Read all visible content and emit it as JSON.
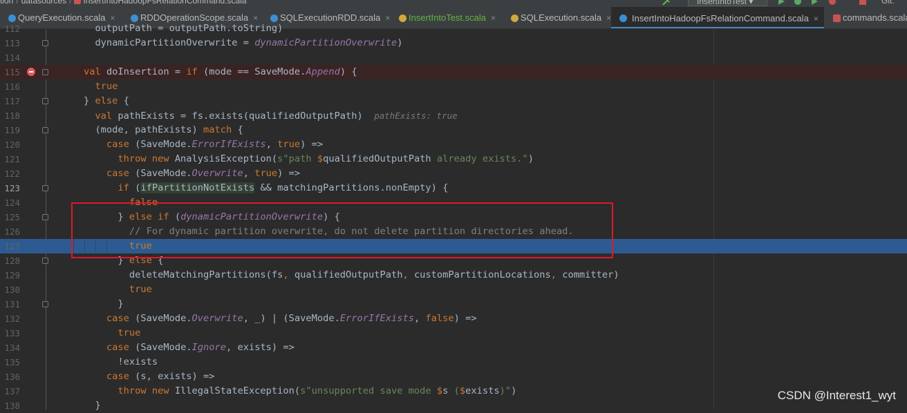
{
  "breadcrumbs": [
    "tion",
    "datasources",
    "InsertIntoHadoopFsRelationCommand.scala"
  ],
  "toolbar": {
    "run_config": "InsertIntoTest",
    "git_label": "Git:"
  },
  "tabs": [
    {
      "label": "QueryExecution.scala",
      "icon": "scala-class-icon"
    },
    {
      "label": "RDDOperationScope.scala",
      "icon": "scala-class-icon"
    },
    {
      "label": "SQLExecutionRDD.scala",
      "icon": "scala-class-icon"
    },
    {
      "label": "InsertIntoTest.scala",
      "icon": "scala-object-icon"
    },
    {
      "label": "SQLExecution.scala",
      "icon": "scala-object-icon"
    },
    {
      "label": "InsertIntoHadoopFsRelationCommand.scala",
      "icon": "scala-class-icon",
      "active": true
    },
    {
      "label": "commands.scala",
      "icon": "scala-file-icon"
    }
  ],
  "editor": {
    "breakpoint_line": "115",
    "current_line": "127",
    "lines": [
      {
        "n": "112",
        "t": [
          {
            "c": "pl",
            "s": "      outputPath = outputPath.toString)"
          }
        ]
      },
      {
        "n": "113",
        "t": [
          {
            "c": "pl",
            "s": "      dynamicPartitionOverwrite = "
          },
          {
            "c": "it",
            "s": "dynamicPartitionOverwrite"
          },
          {
            "c": "pl",
            "s": ")"
          }
        ]
      },
      {
        "n": "114",
        "t": []
      },
      {
        "n": "115",
        "t": [
          {
            "c": "kw",
            "s": "    val "
          },
          {
            "c": "pl",
            "s": "doInsertion = "
          },
          {
            "c": "kw",
            "s": "if "
          },
          {
            "c": "pl",
            "s": "(mode == SaveMode."
          },
          {
            "c": "it",
            "s": "Append"
          },
          {
            "c": "pl",
            "s": ") {"
          }
        ]
      },
      {
        "n": "116",
        "t": [
          {
            "c": "kw",
            "s": "      true"
          }
        ]
      },
      {
        "n": "117",
        "t": [
          {
            "c": "pl",
            "s": "    } "
          },
          {
            "c": "kw",
            "s": "else "
          },
          {
            "c": "pl",
            "s": "{"
          }
        ]
      },
      {
        "n": "118",
        "t": [
          {
            "c": "kw",
            "s": "      val "
          },
          {
            "c": "pl",
            "s": "pathExists = fs.exists(qualifiedOutputPath)  "
          },
          {
            "c": "hint",
            "s": "pathExists: true"
          }
        ]
      },
      {
        "n": "119",
        "t": [
          {
            "c": "pl",
            "s": "      (mode, pathExists) "
          },
          {
            "c": "kw",
            "s": "match "
          },
          {
            "c": "pl",
            "s": "{"
          }
        ]
      },
      {
        "n": "120",
        "t": [
          {
            "c": "kw",
            "s": "        case "
          },
          {
            "c": "pl",
            "s": "(SaveMode."
          },
          {
            "c": "it",
            "s": "ErrorIfExists"
          },
          {
            "c": "pl",
            "s": ", "
          },
          {
            "c": "kw",
            "s": "true"
          },
          {
            "c": "pl",
            "s": ") =>"
          }
        ]
      },
      {
        "n": "121",
        "t": [
          {
            "c": "kw",
            "s": "          throw new "
          },
          {
            "c": "pl",
            "s": "AnalysisException("
          },
          {
            "c": "str",
            "s": "s\"path "
          },
          {
            "c": "kw",
            "s": "$"
          },
          {
            "c": "pl",
            "s": "qualifiedOutputPath"
          },
          {
            "c": "str",
            "s": " already exists.\""
          },
          {
            "c": "pl",
            "s": ")"
          }
        ]
      },
      {
        "n": "122",
        "t": [
          {
            "c": "kw",
            "s": "        case "
          },
          {
            "c": "pl",
            "s": "(SaveMode."
          },
          {
            "c": "it",
            "s": "Overwrite"
          },
          {
            "c": "pl",
            "s": ", "
          },
          {
            "c": "kw",
            "s": "true"
          },
          {
            "c": "pl",
            "s": ") =>"
          }
        ]
      },
      {
        "n": "123",
        "t": [
          {
            "c": "kw",
            "s": "          if "
          },
          {
            "c": "pl",
            "s": "("
          },
          {
            "c": "tok-hl",
            "s": "ifPartitionNotExists"
          },
          {
            "c": "pl",
            "s": " && matchingPartitions.nonEmpty) {"
          }
        ]
      },
      {
        "n": "124",
        "t": [
          {
            "c": "kw",
            "s": "            false"
          }
        ]
      },
      {
        "n": "125",
        "t": [
          {
            "c": "pl",
            "s": "          } "
          },
          {
            "c": "kw",
            "s": "else if "
          },
          {
            "c": "pl",
            "s": "("
          },
          {
            "c": "it",
            "s": "dynamicPartitionOverwrite"
          },
          {
            "c": "pl",
            "s": ") {"
          }
        ]
      },
      {
        "n": "126",
        "t": [
          {
            "c": "cm",
            "s": "            // For dynamic partition overwrite, do not delete partition directories ahead."
          }
        ]
      },
      {
        "n": "127",
        "t": [
          {
            "c": "kw",
            "s": "            true"
          }
        ]
      },
      {
        "n": "128",
        "t": [
          {
            "c": "pl",
            "s": "          } "
          },
          {
            "c": "kw",
            "s": "else "
          },
          {
            "c": "pl",
            "s": "{"
          }
        ]
      },
      {
        "n": "129",
        "t": [
          {
            "c": "pl",
            "s": "            deleteMatchingPartitions(fs"
          },
          {
            "c": "kw",
            "s": ", "
          },
          {
            "c": "pl",
            "s": "qualifiedOutputPath"
          },
          {
            "c": "kw",
            "s": ", "
          },
          {
            "c": "pl",
            "s": "customPartitionLocations"
          },
          {
            "c": "kw",
            "s": ", "
          },
          {
            "c": "pl",
            "s": "committer)"
          }
        ]
      },
      {
        "n": "130",
        "t": [
          {
            "c": "kw",
            "s": "            true"
          }
        ]
      },
      {
        "n": "131",
        "t": [
          {
            "c": "pl",
            "s": "          }"
          }
        ]
      },
      {
        "n": "132",
        "t": [
          {
            "c": "kw",
            "s": "        case "
          },
          {
            "c": "pl",
            "s": "(SaveMode."
          },
          {
            "c": "it",
            "s": "Overwrite"
          },
          {
            "c": "pl",
            "s": ", _) | (SaveMode."
          },
          {
            "c": "it",
            "s": "ErrorIfExists"
          },
          {
            "c": "pl",
            "s": ", "
          },
          {
            "c": "kw",
            "s": "false"
          },
          {
            "c": "pl",
            "s": ") =>"
          }
        ]
      },
      {
        "n": "133",
        "t": [
          {
            "c": "kw",
            "s": "          true"
          }
        ]
      },
      {
        "n": "134",
        "t": [
          {
            "c": "kw",
            "s": "        case "
          },
          {
            "c": "pl",
            "s": "(SaveMode."
          },
          {
            "c": "it",
            "s": "Ignore"
          },
          {
            "c": "pl",
            "s": ", exists) =>"
          }
        ]
      },
      {
        "n": "135",
        "t": [
          {
            "c": "pl",
            "s": "          !exists"
          }
        ]
      },
      {
        "n": "136",
        "t": [
          {
            "c": "kw",
            "s": "        case "
          },
          {
            "c": "pl",
            "s": "(s, exists) =>"
          }
        ]
      },
      {
        "n": "137",
        "t": [
          {
            "c": "kw",
            "s": "          throw new "
          },
          {
            "c": "pl",
            "s": "IllegalStateException("
          },
          {
            "c": "str",
            "s": "s\"unsupported save mode "
          },
          {
            "c": "kw",
            "s": "$"
          },
          {
            "c": "pl",
            "s": "s"
          },
          {
            "c": "str",
            "s": " ("
          },
          {
            "c": "kw",
            "s": "$"
          },
          {
            "c": "pl",
            "s": "exists"
          },
          {
            "c": "str",
            "s": ")\""
          },
          {
            "c": "pl",
            "s": ")"
          }
        ]
      },
      {
        "n": "138",
        "t": [
          {
            "c": "pl",
            "s": "      }"
          }
        ]
      }
    ]
  },
  "watermark": "CSDN @Interest1_wyt"
}
